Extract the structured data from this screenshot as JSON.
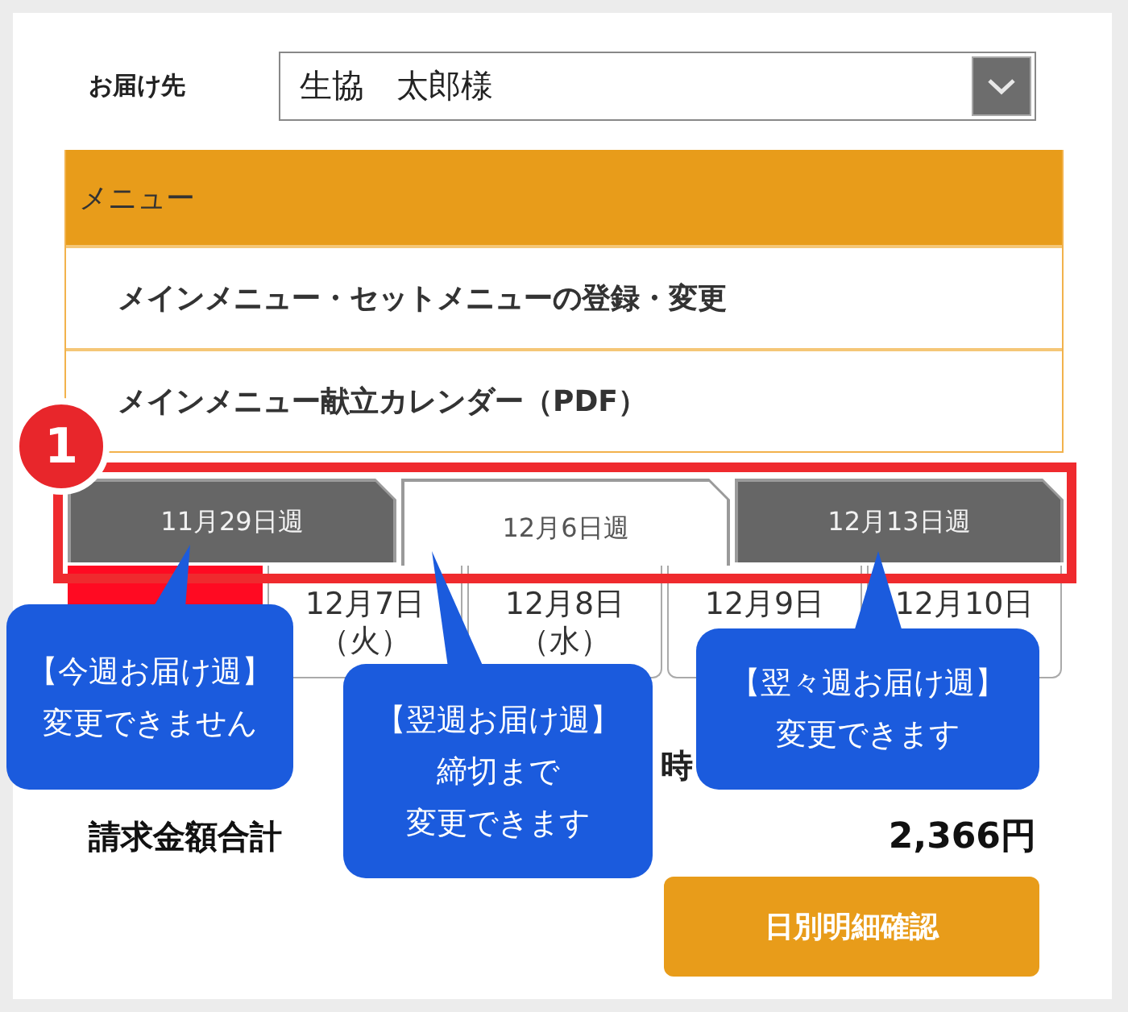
{
  "recipient": {
    "label": "お届け先",
    "value": "生協　太郎様"
  },
  "menu": {
    "title": "メニュー",
    "items": [
      "メインメニュー・セットメニューの登録・変更",
      "メインメニュー献立カレンダー（PDF）"
    ]
  },
  "week_tabs": [
    {
      "label": "11月29日週",
      "selected": false
    },
    {
      "label": "12月6日週",
      "selected": true
    },
    {
      "label": "12月13日週",
      "selected": false
    }
  ],
  "days": [
    {
      "selected": true
    },
    {
      "date": "12月7日",
      "weekday": "（火）",
      "selected": false
    },
    {
      "date": "12月8日",
      "weekday": "（水）",
      "selected": false
    },
    {
      "date": "12月9日",
      "selected": false
    },
    {
      "date": "12月10日",
      "selected": false
    }
  ],
  "covered_row": {
    "text": "時"
  },
  "total": {
    "label": "請求金額合計",
    "amount": "2,366円"
  },
  "detail_button": {
    "label": "日別明細確認"
  },
  "annotations": {
    "step": "1",
    "callouts": [
      {
        "lines": [
          "【今週お届け週】",
          "変更できません"
        ]
      },
      {
        "lines": [
          "【翌週お届け週】",
          "締切まで",
          "変更できます"
        ]
      },
      {
        "lines": [
          "【翌々週お届け週】",
          "変更できます"
        ]
      }
    ]
  }
}
